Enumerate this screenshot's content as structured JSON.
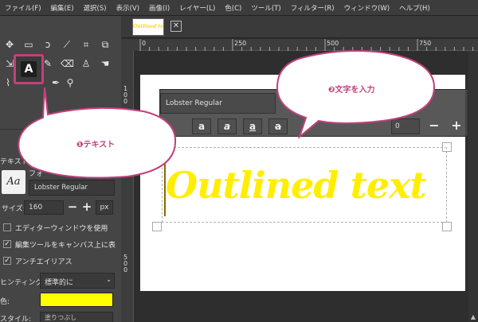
{
  "menu": [
    "ファイル(F)",
    "編集(E)",
    "選択(S)",
    "表示(V)",
    "画像(I)",
    "レイヤー(L)",
    "色(C)",
    "ツール(T)",
    "フィルター(R)",
    "ウィンドウ(W)",
    "ヘルプ(H)"
  ],
  "tools": {
    "row1": [
      "move-icon",
      "rect-select-icon",
      "lasso-icon",
      "fuzzy-select-icon",
      "crop-icon",
      "unified-transform-icon"
    ],
    "text_tool_glyph": "A"
  },
  "tab": {
    "thumb_text": "Outlined text"
  },
  "ruler": {
    "h_labels": [
      "0",
      "250",
      "500",
      "750"
    ],
    "v_labels": [
      "1",
      "0",
      "0",
      "5",
      "0",
      "0"
    ]
  },
  "text_toolbar": {
    "font": "Lobster Regular",
    "buttons": [
      "a",
      "a",
      "a",
      "a"
    ],
    "value": "0",
    "minus": "−",
    "plus": "+"
  },
  "options": {
    "title": "テキスト",
    "font_label": "フォ",
    "font_preview": "Aa",
    "font_name": "Lobster Regular",
    "size_label": "サイズ:",
    "size_value": "160",
    "size_minus": "−",
    "size_plus": "+",
    "unit": "px",
    "use_editor": "エディターウィンドウを使用",
    "edit_on_canvas": "編集ツールをキャンバス上に表",
    "antialias": "アンチエイリアス",
    "hinting_label": "ヒンティング:",
    "hinting_value": "標準的に",
    "color_label": "色:",
    "text_color": "#ffff00",
    "style_label": "スタイル:",
    "style_value": "塗りつぶし"
  },
  "canvas": {
    "text": "Outlined text",
    "text_color": "#ffee00"
  },
  "callouts": {
    "one": "❶テキスト",
    "two": "❷文字を入力",
    "accent": "#c2407b"
  }
}
